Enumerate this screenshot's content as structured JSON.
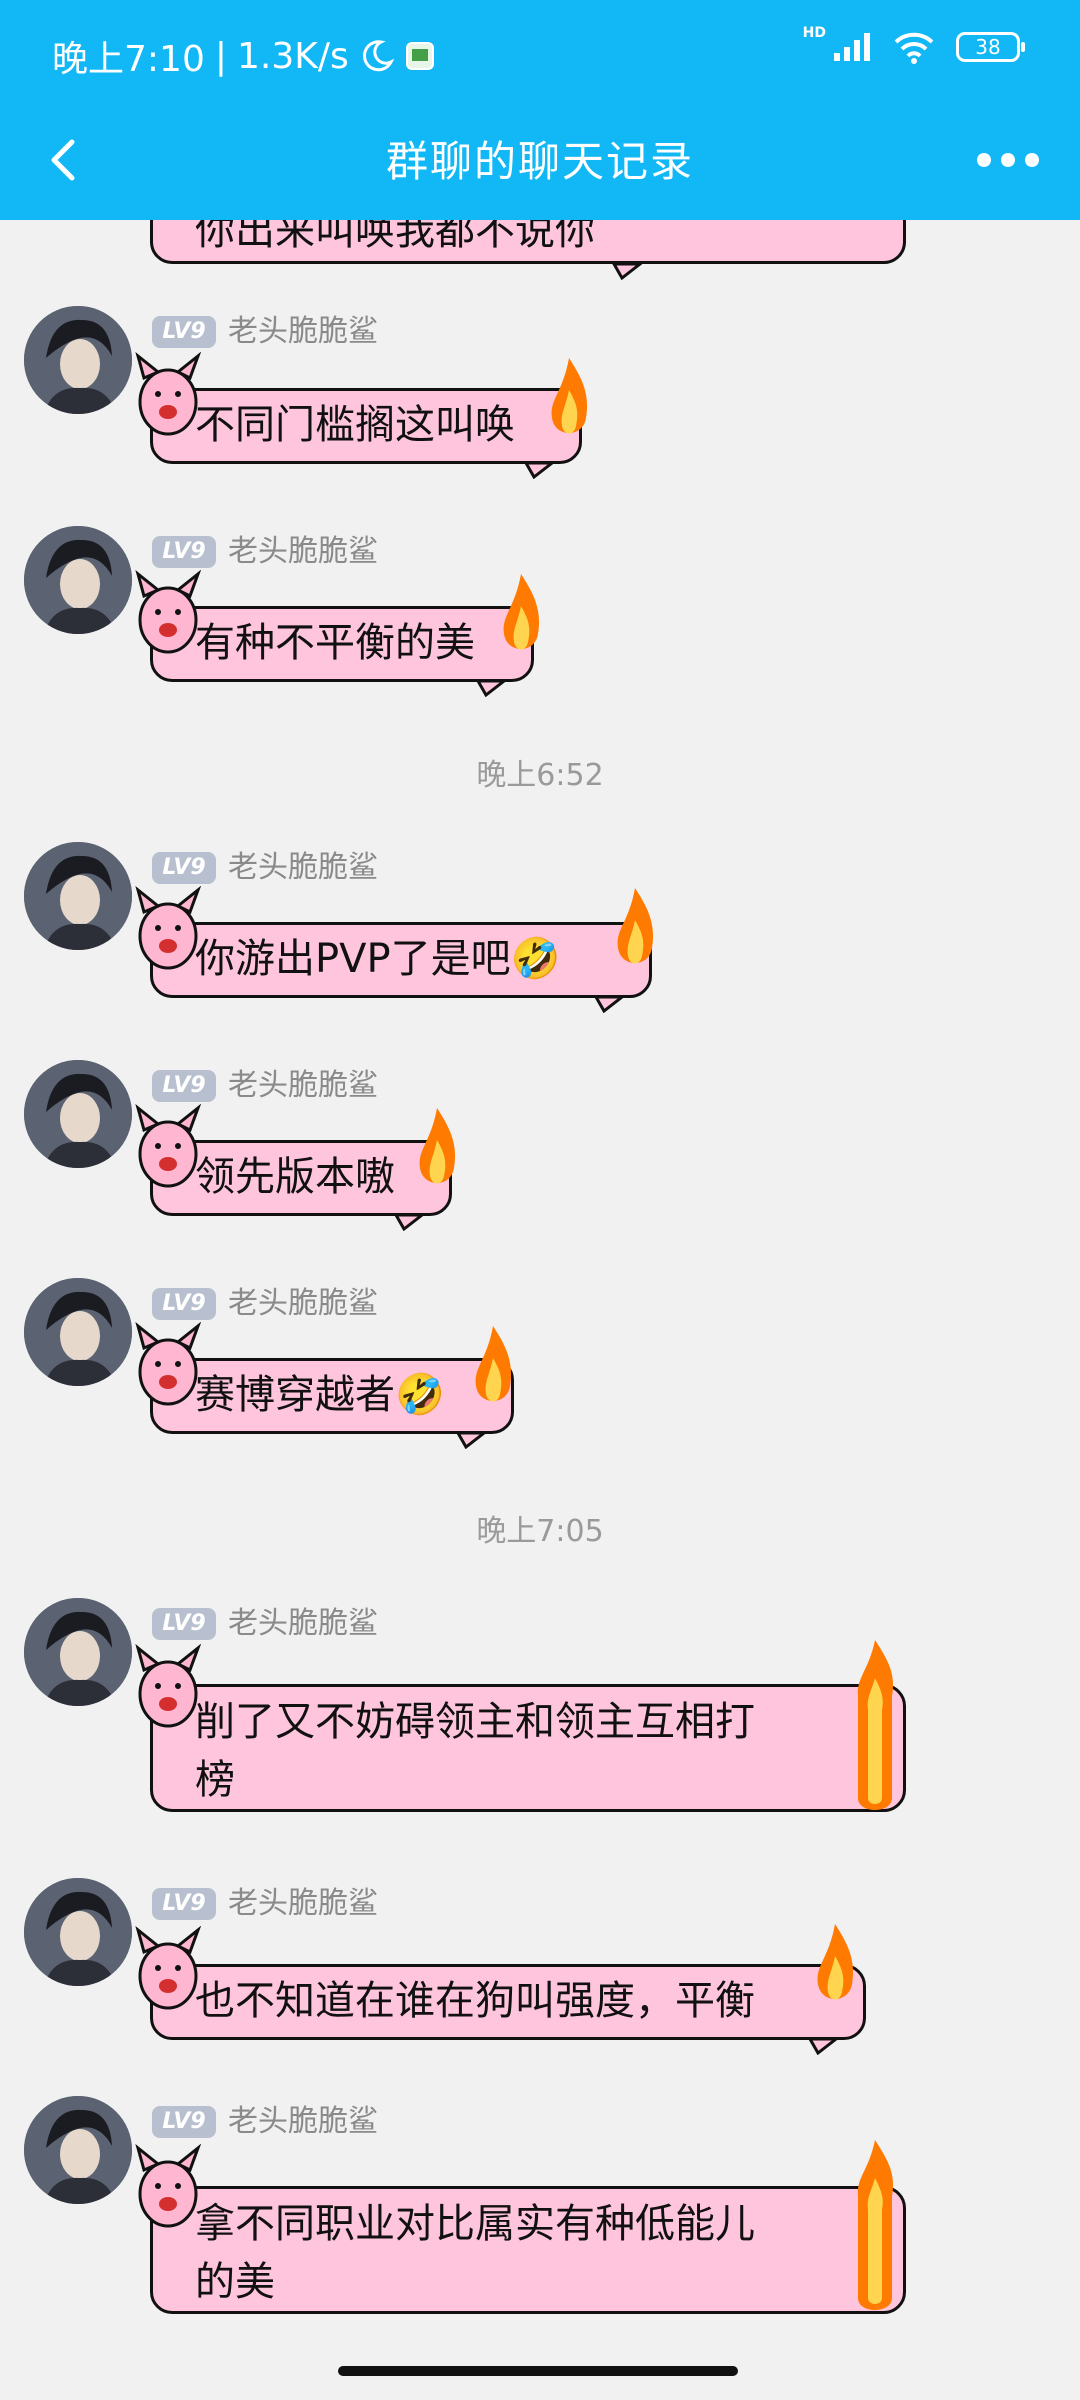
{
  "status": {
    "time": "晚上7:10",
    "speed": "1.3K/s",
    "net": "HD",
    "battery": "38"
  },
  "nav": {
    "title": "群聊的聊天记录"
  },
  "messages": [
    {
      "sender": "老头脆脆鲨",
      "level": "LV9",
      "text": "你出来叫唤我都不说你"
    },
    {
      "sender": "老头脆脆鲨",
      "level": "LV9",
      "text": "不同门槛搁这叫唤"
    },
    {
      "sender": "老头脆脆鲨",
      "level": "LV9",
      "text": "有种不平衡的美"
    },
    {
      "sender": "老头脆脆鲨",
      "level": "LV9",
      "text": "你游出PVP了是吧🤣"
    },
    {
      "sender": "老头脆脆鲨",
      "level": "LV9",
      "text": "领先版本嗷"
    },
    {
      "sender": "老头脆脆鲨",
      "level": "LV9",
      "text": "赛博穿越者🤣"
    },
    {
      "sender": "老头脆脆鲨",
      "level": "LV9",
      "text": "削了又不妨碍领主和领主互相打",
      "text2": "榜"
    },
    {
      "sender": "老头脆脆鲨",
      "level": "LV9",
      "text": "也不知道在谁在狗叫强度，平衡"
    },
    {
      "sender": "老头脆脆鲨",
      "level": "LV9",
      "text": "拿不同职业对比属实有种低能儿",
      "text2": "的美"
    }
  ],
  "timestamps": [
    "晚上6:52",
    "晚上7:05"
  ],
  "colors": {
    "header": "#12b7f5",
    "bubble": "#ffc5dc",
    "background": "#f1f1f1"
  }
}
